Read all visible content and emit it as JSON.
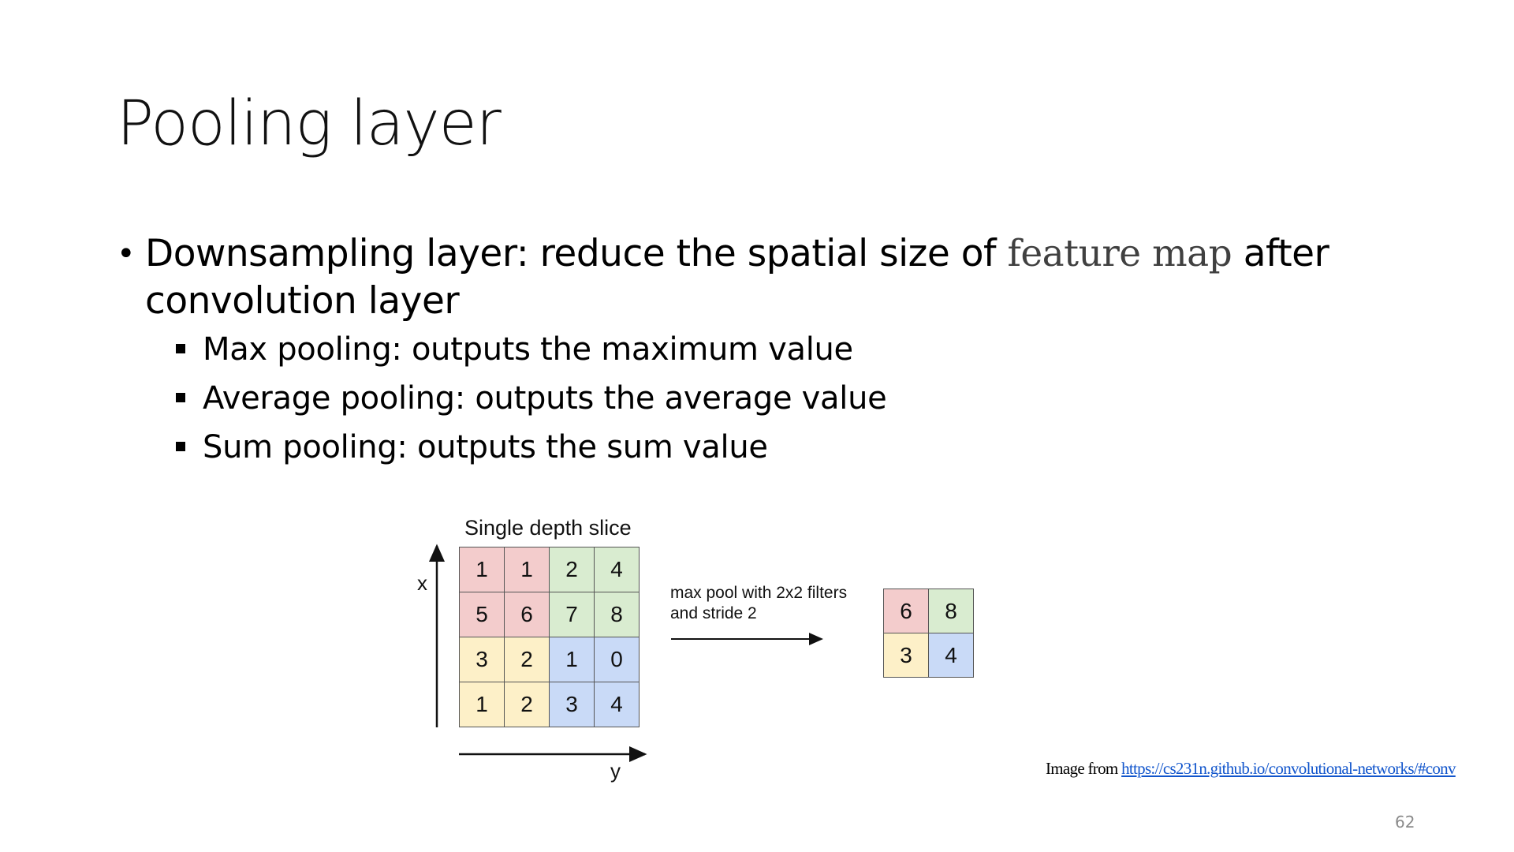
{
  "slide": {
    "title": "Pooling layer",
    "bullet_main_pre": "Downsampling layer: reduce the spatial size of ",
    "bullet_main_serif": "feature map",
    "bullet_main_post": " after convolution layer",
    "sub_bullets": [
      "Max pooling: outputs the maximum value",
      "Average pooling: outputs the average value",
      "Sum pooling: outputs the sum value"
    ],
    "page_number": "62"
  },
  "figure": {
    "caption": "Single depth slice",
    "axis_x_label": "x",
    "axis_y_label": "y",
    "input_grid": [
      [
        "1",
        "1",
        "2",
        "4"
      ],
      [
        "5",
        "6",
        "7",
        "8"
      ],
      [
        "3",
        "2",
        "1",
        "0"
      ],
      [
        "1",
        "2",
        "3",
        "4"
      ]
    ],
    "operation_line1": "max pool with 2x2 filters",
    "operation_line2": "and stride 2",
    "output_grid": [
      [
        "6",
        "8"
      ],
      [
        "3",
        "4"
      ]
    ],
    "colors": {
      "red": "#f3cccc",
      "green": "#d9ecd0",
      "yellow": "#fdf0c8",
      "blue": "#c9daf7"
    }
  },
  "credit": {
    "prefix": "Image from ",
    "link_text": "https://cs231n.github.io/convolutional-networks/#conv"
  }
}
